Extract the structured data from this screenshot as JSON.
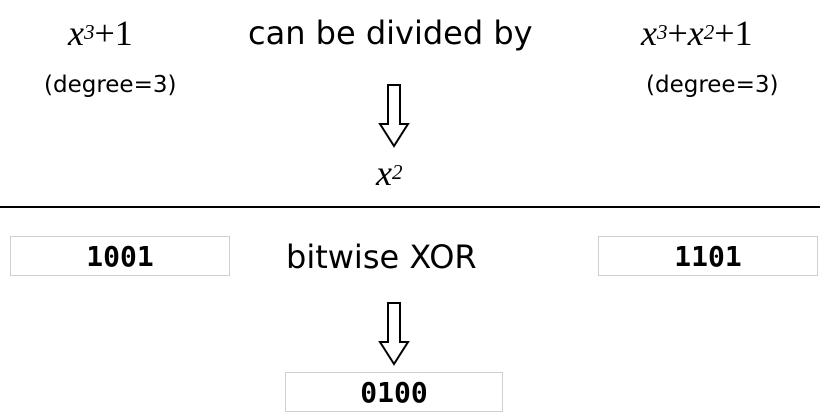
{
  "top": {
    "left_poly": {
      "base": "x",
      "exp": "3",
      "rest": "+1"
    },
    "left_degree": "(degree=3)",
    "relation": "can be divided by",
    "right_poly": {
      "p1": "x",
      "e1": "3",
      "op1": "+",
      "p2": "x",
      "e2": "2",
      "rest": "+1"
    },
    "right_degree": "(degree=3)",
    "result": {
      "base": "x",
      "exp": "2"
    }
  },
  "bottom": {
    "left_bits": "1001",
    "operation": "bitwise XOR",
    "right_bits": "1101",
    "result_bits": "0100"
  }
}
